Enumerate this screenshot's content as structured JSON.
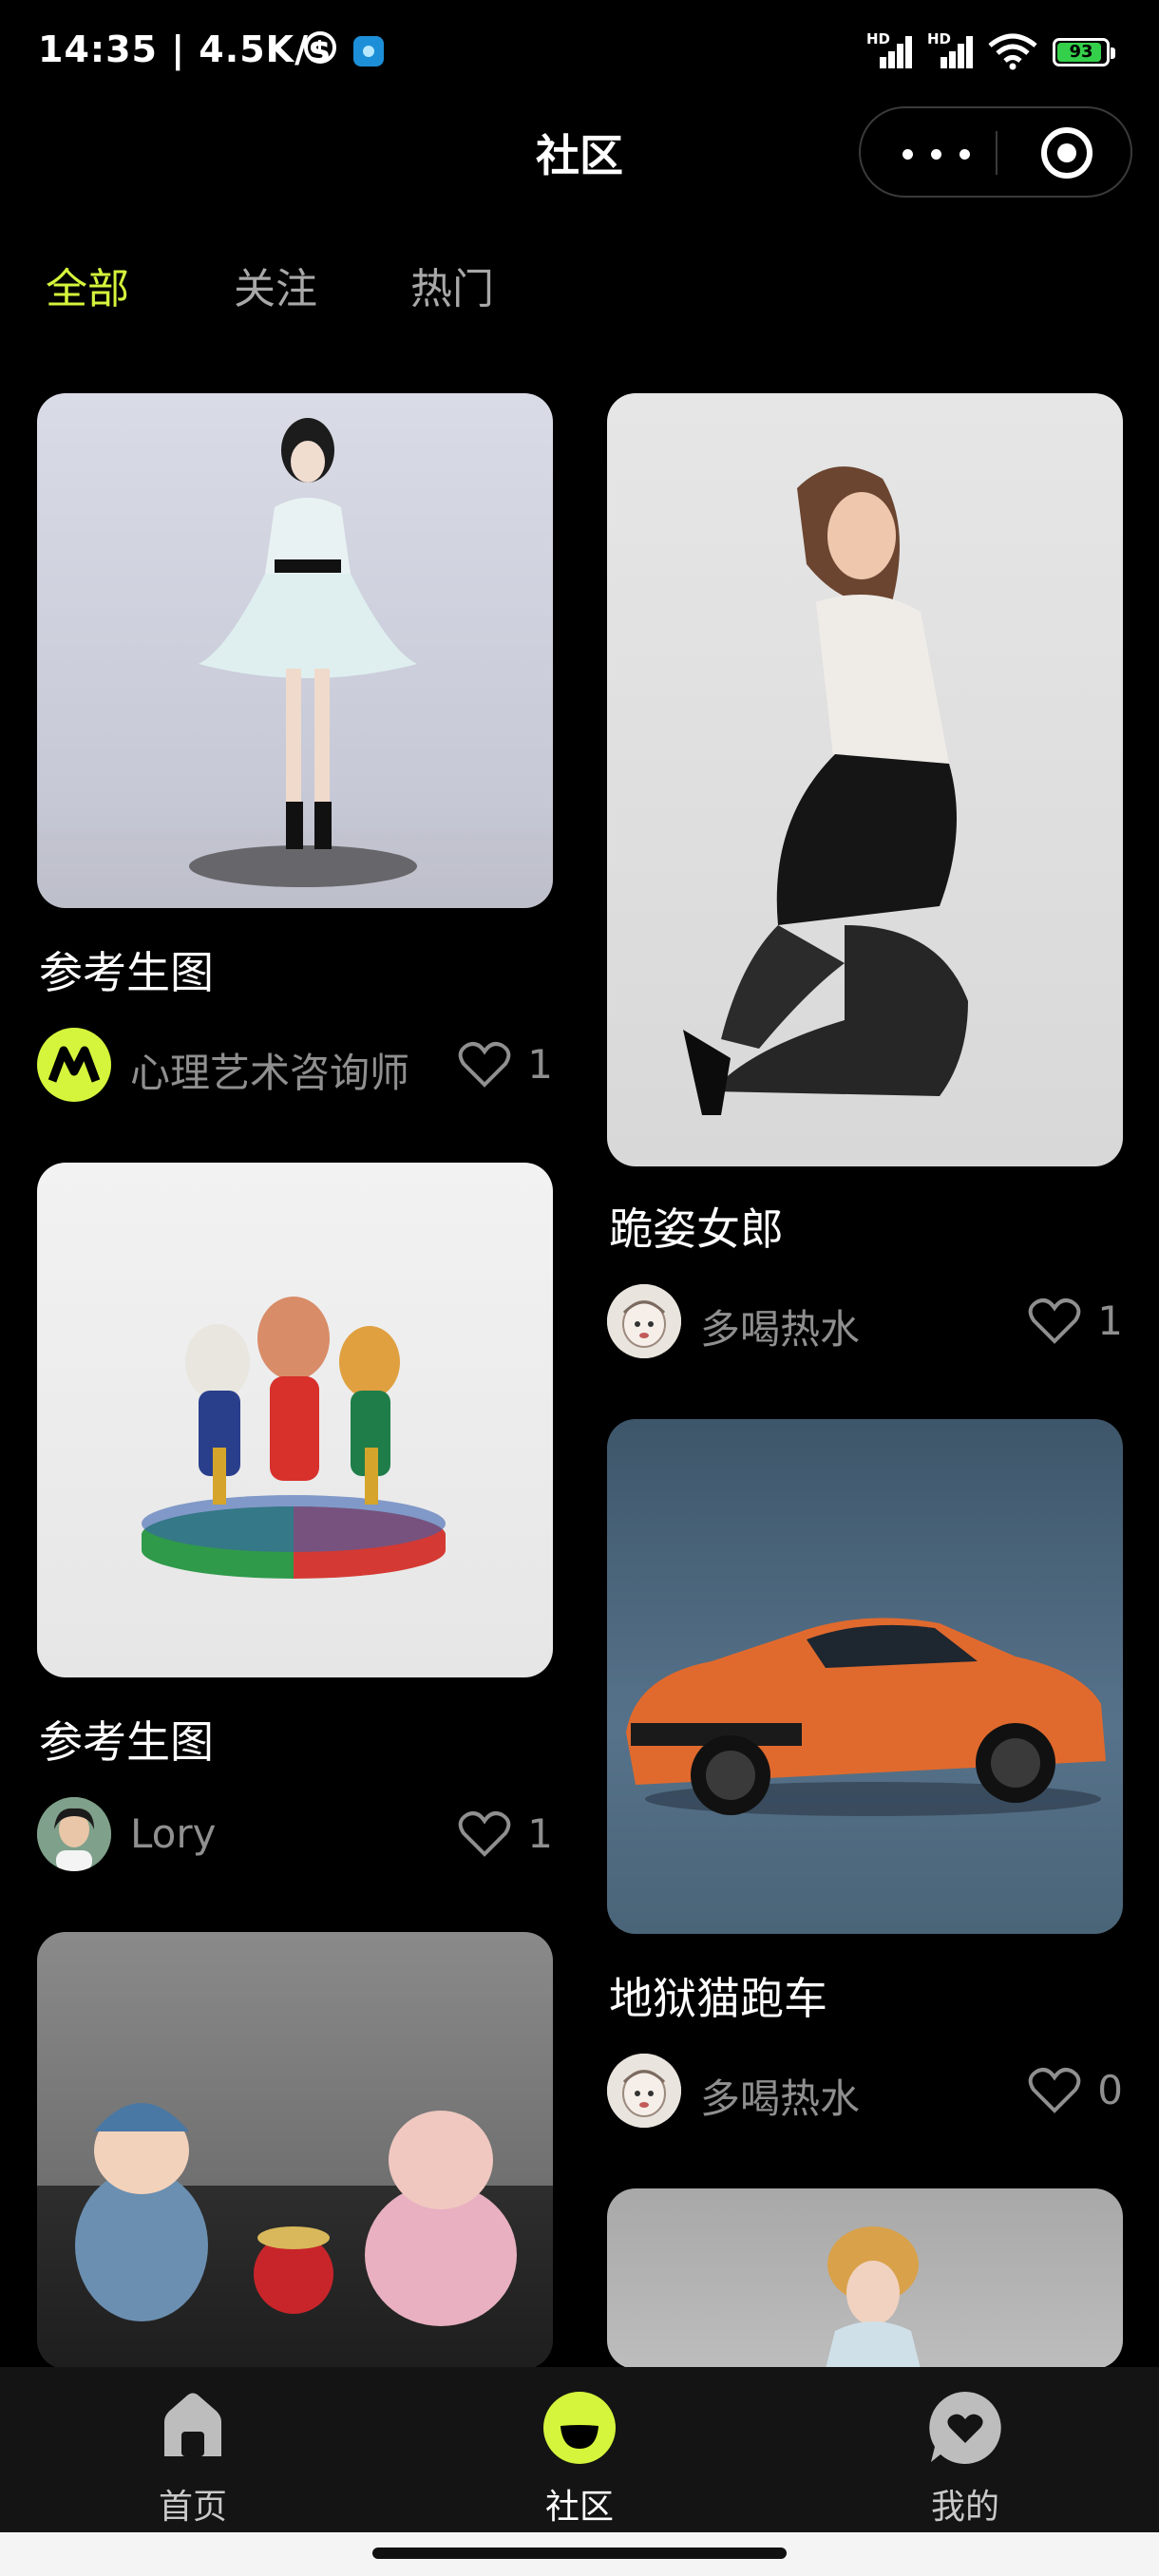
{
  "status_bar": {
    "time": "14:35",
    "net_speed": "| 4.5K/s",
    "signal1_label": "HD",
    "signal2_label": "HD",
    "battery": "93",
    "battery_color": "#35d04b"
  },
  "header": {
    "title": "社区",
    "capsule_more_icon": "more-dots-icon",
    "capsule_close_icon": "target-close-icon"
  },
  "tabs": [
    {
      "label": "全部",
      "active": true
    },
    {
      "label": "关注",
      "active": false
    },
    {
      "label": "热门",
      "active": false
    }
  ],
  "accent_color": "#d4f53c",
  "posts_left": [
    {
      "title": "参考生图",
      "author": "心理艺术咨询师",
      "likes": "1",
      "image": "white-dress-figurine"
    },
    {
      "title": "参考生图",
      "author": "Lory",
      "likes": "1",
      "image": "mascot-figurines"
    },
    {
      "title": "",
      "author": "",
      "likes": "",
      "image": "chubby-figurines"
    }
  ],
  "posts_right": [
    {
      "title": "跪姿女郎",
      "author": "多喝热水",
      "likes": "1",
      "image": "kneeling-woman"
    },
    {
      "title": "地狱猫跑车",
      "author": "多喝热水",
      "likes": "0",
      "image": "orange-sports-car"
    },
    {
      "title": "",
      "author": "",
      "likes": "",
      "image": "costume-figurine"
    }
  ],
  "tab_bar": [
    {
      "label": "首页",
      "icon": "home-icon",
      "active": false
    },
    {
      "label": "社区",
      "icon": "community-icon",
      "active": true
    },
    {
      "label": "我的",
      "icon": "profile-heart-icon",
      "active": false
    }
  ]
}
